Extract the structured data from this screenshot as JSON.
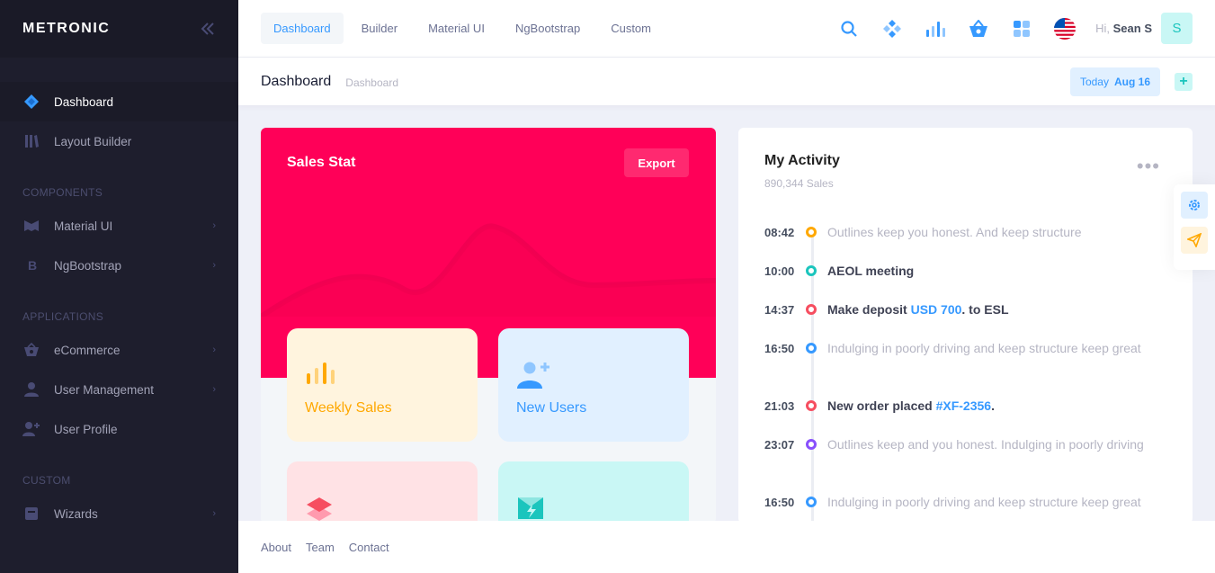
{
  "brand": {
    "name": "METRONIC"
  },
  "sidebar": {
    "items": [
      {
        "label": "Dashboard"
      },
      {
        "label": "Layout Builder"
      }
    ],
    "sections": [
      {
        "title": "COMPONENTS",
        "items": [
          {
            "label": "Material UI"
          },
          {
            "label": "NgBootstrap"
          }
        ]
      },
      {
        "title": "APPLICATIONS",
        "items": [
          {
            "label": "eCommerce"
          },
          {
            "label": "User Management"
          },
          {
            "label": "User Profile"
          }
        ]
      },
      {
        "title": "CUSTOM",
        "items": [
          {
            "label": "Wizards"
          }
        ]
      }
    ]
  },
  "header": {
    "nav": [
      "Dashboard",
      "Builder",
      "Material UI",
      "NgBootstrap",
      "Custom"
    ],
    "greeting": "Hi,",
    "user_name": "Sean S",
    "avatar_letter": "S"
  },
  "subheader": {
    "title": "Dashboard",
    "breadcrumb": "Dashboard",
    "date_label": "Today",
    "date_value": "Aug 16",
    "add_label": "+"
  },
  "sales": {
    "title": "Sales Stat",
    "export_label": "Export",
    "tiles": [
      {
        "label": "Weekly Sales",
        "color": "#ffa800"
      },
      {
        "label": "New Users",
        "color": "#3699ff"
      },
      {
        "label": "",
        "color": "#f64e60"
      },
      {
        "label": "",
        "color": "#1bc5bd"
      }
    ]
  },
  "activity": {
    "title": "My Activity",
    "subtitle": "890,344 Sales",
    "items": [
      {
        "time": "08:42",
        "color": "#ffa800",
        "text": "Outlines keep you honest. And keep structure"
      },
      {
        "time": "10:00",
        "color": "#1bc5bd",
        "text": "AEOL meeting"
      },
      {
        "time": "14:37",
        "color": "#f64e60",
        "text_before": "Make deposit ",
        "highlight": "USD 700",
        "text_after": ". to ESL"
      },
      {
        "time": "16:50",
        "color": "#3699ff",
        "text": "Indulging in poorly driving and keep structure keep great"
      },
      {
        "time": "21:03",
        "color": "#f64e60",
        "text_before": "New order placed ",
        "highlight": "#XF-2356",
        "text_after": "."
      },
      {
        "time": "23:07",
        "color": "#8950fc",
        "text": "Outlines keep and you honest. Indulging in poorly driving"
      },
      {
        "time": "16:50",
        "color": "#3699ff",
        "text": "Indulging in poorly driving and keep structure keep great"
      }
    ]
  },
  "footer": {
    "links": [
      "About",
      "Team",
      "Contact"
    ]
  },
  "colors": {
    "accent": "#3699ff",
    "sales_bg": "#ff0058",
    "sidebar_bg": "#1e1e2d"
  }
}
